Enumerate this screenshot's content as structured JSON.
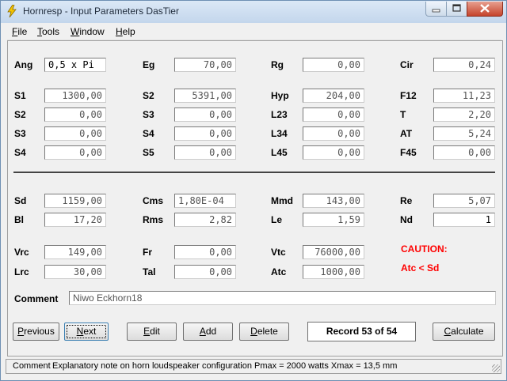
{
  "window": {
    "title": "Hornresp - Input Parameters   DasTier"
  },
  "menu": [
    "File",
    "Tools",
    "Window",
    "Help"
  ],
  "params": [
    {
      "id": "ang",
      "label": "Ang",
      "value": "0,5 x Pi",
      "align": "left",
      "dark": true
    },
    {
      "id": "eg",
      "label": "Eg",
      "value": "70,00"
    },
    {
      "id": "rg",
      "label": "Rg",
      "value": "0,00"
    },
    {
      "id": "cir",
      "label": "Cir",
      "value": "0,24"
    },
    {
      "id": "s1",
      "label": "S1",
      "value": "1300,00"
    },
    {
      "id": "s2a",
      "label": "S2",
      "value": "5391,00"
    },
    {
      "id": "hyp",
      "label": "Hyp",
      "value": "204,00"
    },
    {
      "id": "f12",
      "label": "F12",
      "value": "11,23"
    },
    {
      "id": "s2",
      "label": "S2",
      "value": "0,00"
    },
    {
      "id": "s3a",
      "label": "S3",
      "value": "0,00"
    },
    {
      "id": "l23",
      "label": "L23",
      "value": "0,00"
    },
    {
      "id": "t",
      "label": "T",
      "value": "2,20"
    },
    {
      "id": "s3",
      "label": "S3",
      "value": "0,00"
    },
    {
      "id": "s4a",
      "label": "S4",
      "value": "0,00"
    },
    {
      "id": "l34",
      "label": "L34",
      "value": "0,00"
    },
    {
      "id": "at",
      "label": "AT",
      "value": "5,24"
    },
    {
      "id": "s4",
      "label": "S4",
      "value": "0,00"
    },
    {
      "id": "s5",
      "label": "S5",
      "value": "0,00"
    },
    {
      "id": "l45",
      "label": "L45",
      "value": "0,00"
    },
    {
      "id": "f45",
      "label": "F45",
      "value": "0,00"
    },
    {
      "id": "sd",
      "label": "Sd",
      "value": "1159,00"
    },
    {
      "id": "cms",
      "label": "Cms",
      "value": "1,80E-04",
      "align": "left"
    },
    {
      "id": "mmd",
      "label": "Mmd",
      "value": "143,00"
    },
    {
      "id": "re",
      "label": "Re",
      "value": "5,07"
    },
    {
      "id": "bl",
      "label": "Bl",
      "value": "17,20"
    },
    {
      "id": "rms",
      "label": "Rms",
      "value": "2,82"
    },
    {
      "id": "le",
      "label": "Le",
      "value": "1,59"
    },
    {
      "id": "nd",
      "label": "Nd",
      "value": "1",
      "dark": true
    },
    {
      "id": "vrc",
      "label": "Vrc",
      "value": "149,00"
    },
    {
      "id": "fr",
      "label": "Fr",
      "value": "0,00"
    },
    {
      "id": "vtc",
      "label": "Vtc",
      "value": "76000,00"
    },
    {
      "id": "lrc",
      "label": "Lrc",
      "value": "30,00"
    },
    {
      "id": "tal",
      "label": "Tal",
      "value": "0,00"
    },
    {
      "id": "atc",
      "label": "Atc",
      "value": "1000,00"
    }
  ],
  "caution": {
    "title": "CAUTION:",
    "message": "Atc < Sd",
    "color": "#ff0000"
  },
  "comment": {
    "label": "Comment",
    "value": "Niwo Eckhorn18"
  },
  "buttons": {
    "previous": "Previous",
    "next": "Next",
    "edit": "Edit",
    "add": "Add",
    "delete": "Delete",
    "calculate": "Calculate"
  },
  "record": "Record 53 of 54",
  "status": {
    "label": "Comment",
    "text": "Explanatory note on horn loudspeaker configuration    Pmax = 2000 watts    Xmax = 13,5 mm"
  },
  "icons": {
    "app": "lightning-icon"
  }
}
